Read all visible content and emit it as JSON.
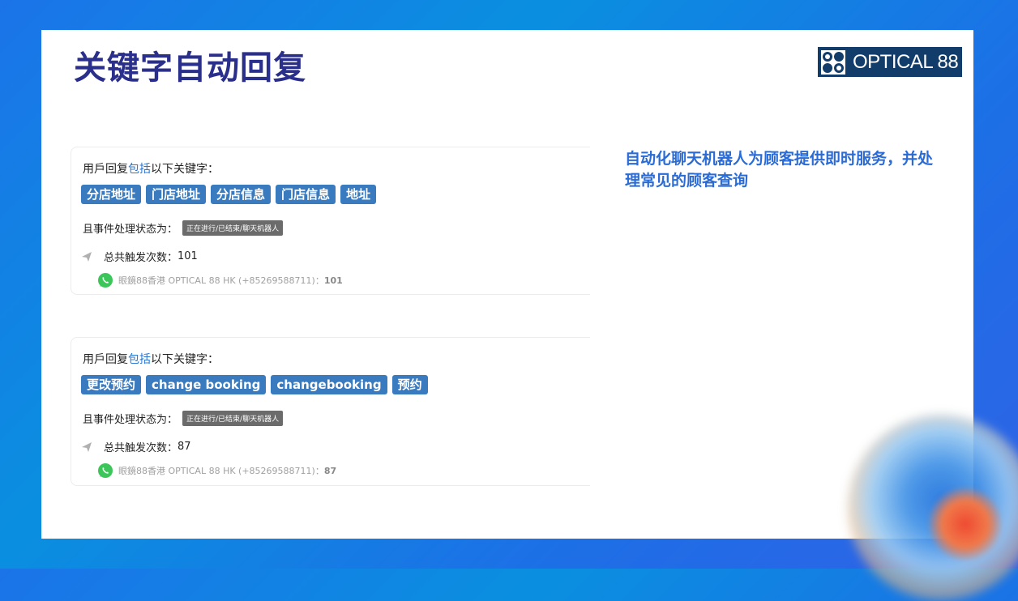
{
  "title": "关键字自动回复",
  "logo": {
    "text": "OPTICAL 88"
  },
  "description": "自动化聊天机器人为顾客提供即时服务，并处理常见的顾客查询",
  "cards": [
    {
      "prefix": "用戶回复",
      "highlight": "包括",
      "suffix": "以下关键字：",
      "keywords": [
        "分店地址",
        "门店地址",
        "分店信息",
        "门店信息",
        "地址"
      ],
      "status_label": "且事件处理状态为：",
      "status_value": "正在进行/已结束/聊天机器人",
      "count_label": "总共触发次数：",
      "count": "101",
      "whatsapp_account": "眼鏡88香港 OPTICAL 88 HK (+85269588711)：",
      "whatsapp_count": "101"
    },
    {
      "prefix": "用戶回复",
      "highlight": "包括",
      "suffix": "以下关键字：",
      "keywords": [
        "更改预约",
        "change booking",
        "changebooking",
        "预约"
      ],
      "status_label": "且事件处理状态为：",
      "status_value": "正在进行/已结束/聊天机器人",
      "count_label": "总共触发次数：",
      "count": "87",
      "whatsapp_account": "眼鏡88香港 OPTICAL 88 HK (+85269588711)：",
      "whatsapp_count": "87"
    }
  ]
}
